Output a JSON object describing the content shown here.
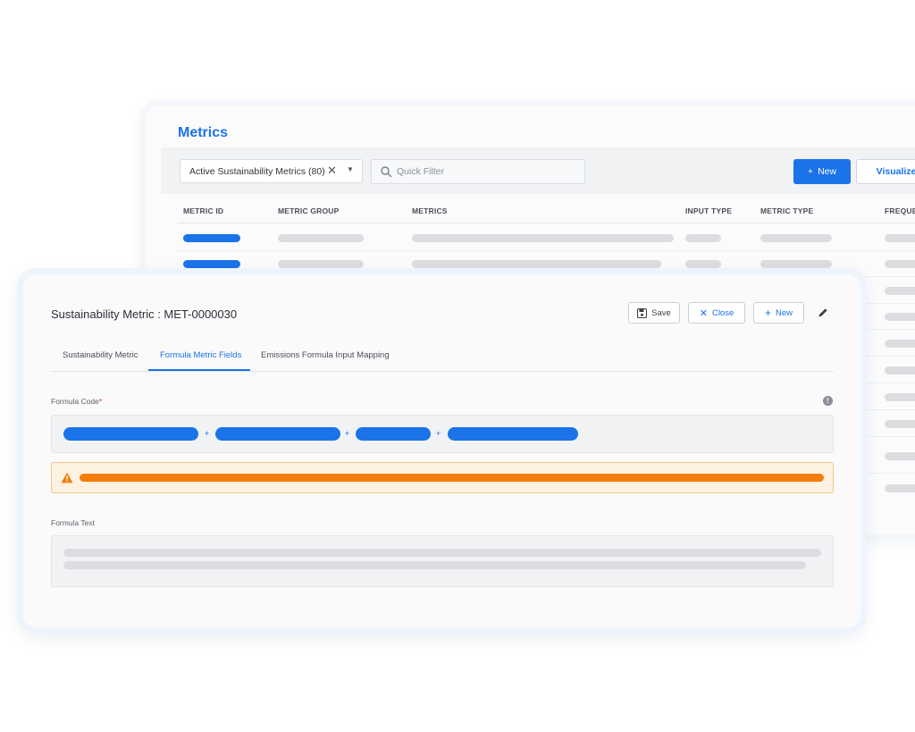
{
  "list_view": {
    "title": "Metrics",
    "filter": {
      "selected": "Active Sustainability Metrics (80)"
    },
    "search": {
      "placeholder": "Quick Filter"
    },
    "buttons": {
      "new_label": "New",
      "visualize_label": "Visualize"
    },
    "columns": [
      "METRIC ID",
      "METRIC GROUP",
      "METRICS",
      "INPUT TYPE",
      "METRIC TYPE",
      "FREQUE"
    ]
  },
  "record": {
    "title": "Sustainability Metric : MET-0000030",
    "actions": {
      "save_label": "Save",
      "close_label": "Close",
      "new_label": "New"
    },
    "tabs": [
      "Sustainability Metric",
      "Formula Metric Fields",
      "Emissions Formula Input Mapping"
    ],
    "active_tab": "Formula Metric Fields",
    "formula_code_label": "Formula Code",
    "formula_text_label": "Formula Text",
    "formula_operators": [
      "+",
      "+",
      "+"
    ],
    "info_icon": "!"
  },
  "colors": {
    "accent": "#1a73e8",
    "warning": "#f47c0b",
    "warning_bg": "#fdf1e1",
    "placeholder": "#dcdde0"
  },
  "icons": [
    "search-icon",
    "close-icon",
    "caret-down-icon",
    "plus-icon",
    "save-icon",
    "edit-icon",
    "info-icon",
    "warning-icon"
  ]
}
